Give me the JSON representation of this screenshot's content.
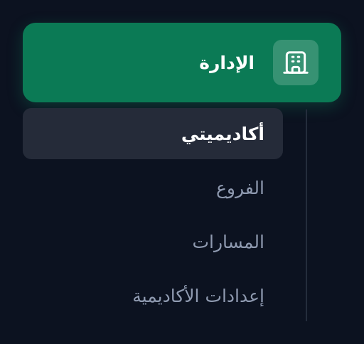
{
  "section": {
    "label": "الإدارة",
    "icon": "building-icon",
    "color": "#0b7a55"
  },
  "submenu": {
    "items": [
      {
        "label": "أكاديميتي",
        "active": true
      },
      {
        "label": "الفروع",
        "active": false
      },
      {
        "label": "المسارات",
        "active": false
      },
      {
        "label": "إعدادات الأكاديمية",
        "active": false
      }
    ]
  }
}
